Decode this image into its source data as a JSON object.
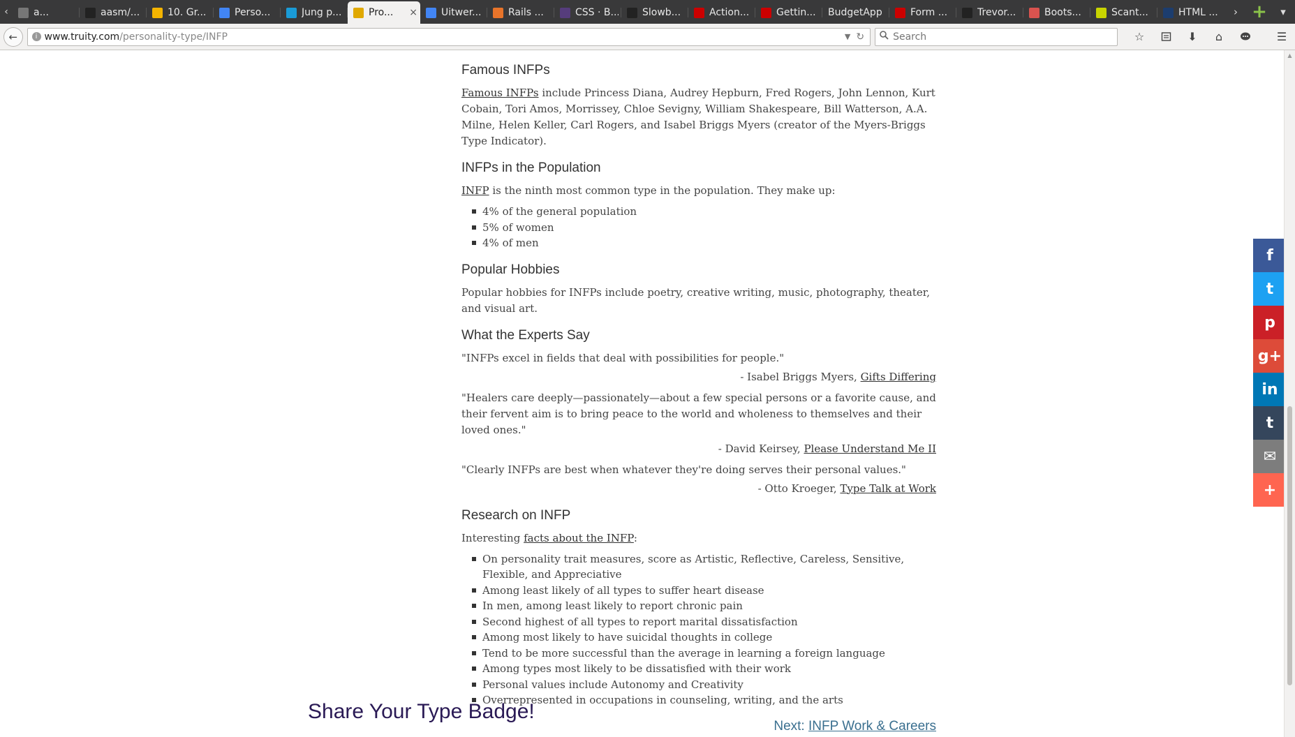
{
  "browser": {
    "tabs": [
      {
        "label": "a...",
        "icon": "generic",
        "color": "#777777"
      },
      {
        "label": "aasm/...",
        "icon": "github",
        "color": "#222222"
      },
      {
        "label": "10. Gr...",
        "icon": "google-drive",
        "color": "#f4b400"
      },
      {
        "label": "Perso...",
        "icon": "google-docs",
        "color": "#4285f4"
      },
      {
        "label": "Jung p...",
        "icon": "site",
        "color": "#1a9bd7"
      },
      {
        "label": "Pro...",
        "icon": "lightbulb",
        "color": "#e0a800",
        "active": true
      },
      {
        "label": "Uitwer...",
        "icon": "google-docs",
        "color": "#4285f4"
      },
      {
        "label": "Rails ...",
        "icon": "site",
        "color": "#e8742a"
      },
      {
        "label": "CSS · B...",
        "icon": "bootstrap",
        "color": "#563d7c"
      },
      {
        "label": "Slowb...",
        "icon": "github",
        "color": "#222222"
      },
      {
        "label": "Action...",
        "icon": "rails",
        "color": "#cc0000"
      },
      {
        "label": "Gettin...",
        "icon": "rails",
        "color": "#cc0000"
      },
      {
        "label": "BudgetApp",
        "icon": "none",
        "color": "#39393a"
      },
      {
        "label": "Form ...",
        "icon": "rails",
        "color": "#cc0000"
      },
      {
        "label": "Trevor...",
        "icon": "github",
        "color": "#222222"
      },
      {
        "label": "Boots...",
        "icon": "site",
        "color": "#d9534f"
      },
      {
        "label": "Scant...",
        "icon": "smiley",
        "color": "#c8d400"
      },
      {
        "label": "HTML ...",
        "icon": "site",
        "color": "#1c3d6e"
      }
    ],
    "close_glyph": "×",
    "url_host": "www.truity.com",
    "url_path": "/personality-type/INFP",
    "search_placeholder": "Search"
  },
  "content": {
    "famous": {
      "heading": "Famous INFPs",
      "link": "Famous INFPs",
      "text": " include Princess Diana, Audrey Hepburn, Fred Rogers, John Lennon, Kurt Cobain, Tori Amos, Morrissey, Chloe Sevigny, William Shakespeare, Bill Watterson, A.A. Milne, Helen Keller, Carl Rogers, and Isabel Briggs Myers (creator of the Myers-Briggs Type Indicator)."
    },
    "population": {
      "heading": "INFPs in the Population",
      "link": "INFP",
      "text": " is the ninth most common type in the population. They make up:",
      "items": [
        "4% of the general population",
        "5% of women",
        "4% of men"
      ]
    },
    "hobbies": {
      "heading": "Popular Hobbies",
      "text": "Popular hobbies for INFPs include poetry, creative writing, music, photography, theater, and visual art."
    },
    "experts": {
      "heading": "What the Experts Say",
      "quotes": [
        {
          "text": "\"INFPs excel in fields that deal with possibilities for people.\"",
          "author": "- Isabel Briggs Myers, ",
          "source": "Gifts Differing"
        },
        {
          "text": "\"Healers care deeply—passionately—about a few special persons or a favorite cause, and their fervent aim is to bring peace to the world and wholeness to themselves and their loved ones.\"",
          "author": "- David Keirsey, ",
          "source": "Please Understand Me II"
        },
        {
          "text": "\"Clearly INFPs are best when whatever they're doing serves their personal values.\"",
          "author": "- Otto Kroeger, ",
          "source": "Type Talk at Work"
        }
      ]
    },
    "research": {
      "heading": "Research on INFP",
      "intro": "Interesting ",
      "link": "facts about the INFP",
      "intro_end": ":",
      "items": [
        "On personality trait measures, score as Artistic, Reflective, Careless, Sensitive, Flexible, and Appreciative",
        "Among least likely of all types to suffer heart disease",
        "In men, among least likely to report chronic pain",
        "Second highest of all types to report marital dissatisfaction",
        "Among most likely to have suicidal thoughts in college",
        "Tend to be more successful than the average in learning a foreign language",
        "Among types most likely to be dissatisfied with their work",
        "Personal values include Autonomy and Creativity",
        "Overrepresented in occupations in counseling, writing, and the arts"
      ]
    },
    "next_prefix": "Next: ",
    "next_link": "INFP Work & Careers",
    "share_title": "Share Your Type Badge!"
  },
  "social": [
    {
      "name": "facebook-icon",
      "glyph": "f",
      "color": "#3b5998"
    },
    {
      "name": "twitter-icon",
      "glyph": "t",
      "color": "#1da1f2"
    },
    {
      "name": "pinterest-icon",
      "glyph": "p",
      "color": "#cb2027"
    },
    {
      "name": "google-plus-icon",
      "glyph": "g+",
      "color": "#dd4b39"
    },
    {
      "name": "linkedin-icon",
      "glyph": "in",
      "color": "#0077b5"
    },
    {
      "name": "tumblr-icon",
      "glyph": "t",
      "color": "#35465c"
    },
    {
      "name": "email-icon",
      "glyph": "✉",
      "color": "#7d7d7d"
    },
    {
      "name": "more-icon",
      "glyph": "+",
      "color": "#ff6550"
    }
  ]
}
